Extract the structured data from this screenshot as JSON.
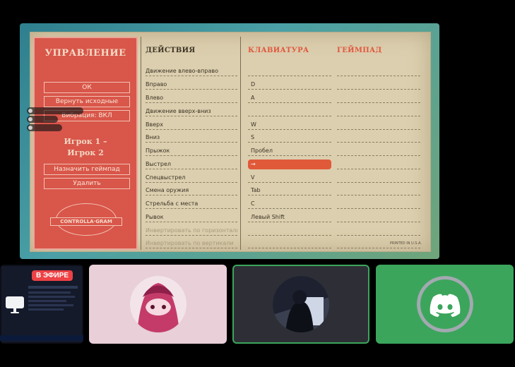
{
  "stream": {
    "left_panel": {
      "title": "УПРАВЛЕНИЕ",
      "buttons": [
        "ОК",
        "Вернуть исходные",
        "Вибрация: ВКЛ",
        "Назначить геймпад",
        "Удалить"
      ],
      "players": [
        "Игрок 1 –",
        "Игрок 2"
      ],
      "logo_text": "CONTROLLA·GRAM"
    },
    "columns": {
      "actions": "ДЕЙСТВИЯ",
      "keyboard": "КЛАВИАТУРА",
      "gamepad": "ГЕЙМПАД"
    },
    "actions": [
      "Движение влево-вправо",
      "Вправо",
      "Влево",
      "Движение вверх-вниз",
      "Вверх",
      "Вниз",
      "Прыжок",
      "Выстрел",
      "Спецвыстрел",
      "Смена оружия",
      "Стрельба с места",
      "Рывок",
      "Инвертировать по горизонтали",
      "Инвертировать по вертикали"
    ],
    "keys": [
      "",
      "D",
      "A",
      "",
      "W",
      "S",
      "Пробел",
      "→",
      "V",
      "Tab",
      "C",
      "Левый Shift",
      "",
      ""
    ],
    "footer_mark": "PRINTED IN U.S.A."
  },
  "colors": {
    "live": "#ed4245",
    "discord_green": "#3ba55c",
    "panel_red": "#d9564a"
  },
  "tiles": {
    "live_label": "В ЭФИРЕ"
  }
}
